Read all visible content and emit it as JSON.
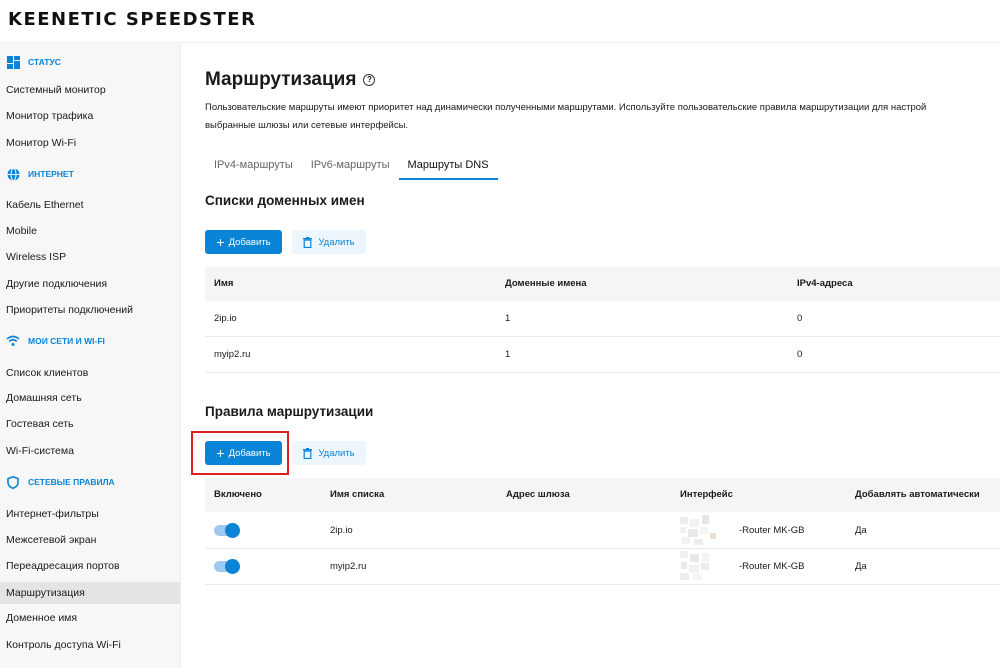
{
  "app": {
    "logo_text": "KEENETIC SPEEDSTER"
  },
  "sidebar": {
    "sections": [
      {
        "label": "СТАТУС",
        "icon": "dashboard-icon",
        "items": [
          "Системный монитор",
          "Монитор трафика",
          "Монитор Wi-Fi"
        ]
      },
      {
        "label": "ИНТЕРНЕТ",
        "icon": "globe-icon",
        "items": [
          "Кабель Ethernet",
          "Mobile",
          "Wireless ISP",
          "Другие подключения",
          "Приоритеты подключений"
        ]
      },
      {
        "label": "МОИ СЕТИ И WI-FI",
        "icon": "wifi-icon",
        "items": [
          "Список клиентов",
          "Домашняя сеть",
          "Гостевая сеть",
          "Wi-Fi-система"
        ]
      },
      {
        "label": "СЕТЕВЫЕ ПРАВИЛА",
        "icon": "shield-icon",
        "items": [
          "Интернет-фильтры",
          "Межсетевой экран",
          "Переадресация портов",
          "Маршрутизация",
          "Доменное имя",
          "Контроль доступа Wi-Fi"
        ]
      }
    ],
    "active_item": "Маршрутизация"
  },
  "page": {
    "title": "Маршрутизация",
    "help_glyph": "?",
    "description_line1": "Пользовательские маршруты имеют приоритет над динамически полученными маршрутами. Используйте пользовательские правила маршрутизации для настрой",
    "description_line2": "выбранные шлюзы или сетевые интерфейсы.",
    "tabs": [
      {
        "label": "IPv4-маршруты",
        "active": false
      },
      {
        "label": "IPv6-маршруты",
        "active": false
      },
      {
        "label": "Маршруты DNS",
        "active": true
      }
    ]
  },
  "domain_lists": {
    "heading": "Списки доменных имен",
    "add_label": "Добавить",
    "delete_label": "Удалить",
    "columns": [
      "Имя",
      "Доменные имена",
      "IPv4-адреса"
    ],
    "rows": [
      {
        "name": "2ip.io",
        "domains": "1",
        "ipv4": "0"
      },
      {
        "name": "myip2.ru",
        "domains": "1",
        "ipv4": "0"
      }
    ]
  },
  "routing_rules": {
    "heading": "Правила маршрутизации",
    "add_label": "Добавить",
    "delete_label": "Удалить",
    "columns": [
      "Включено",
      "Имя списка",
      "Адрес шлюза",
      "Интерфейс",
      "Добавлять автоматически"
    ],
    "rows": [
      {
        "enabled": true,
        "list_name": "2ip.io",
        "gateway": "",
        "interface": "-Router MK-GB",
        "auto_add": "Да"
      },
      {
        "enabled": true,
        "list_name": "myip2.ru",
        "gateway": "",
        "interface": "-Router MK-GB",
        "auto_add": "Да"
      }
    ]
  },
  "colors": {
    "accent": "#0a84d6",
    "highlight": "#e02020",
    "sidebar_bg": "#f7f7f7"
  }
}
